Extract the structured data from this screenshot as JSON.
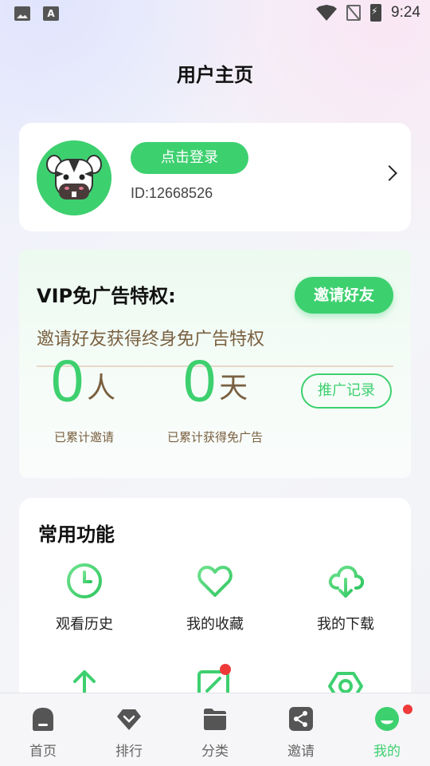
{
  "status_bar": {
    "time": "9:24"
  },
  "page_title": "用户主页",
  "user": {
    "login_label": "点击登录",
    "id_text": "ID:12668526"
  },
  "vip": {
    "title": "VIP免广告特权:",
    "invite_label": "邀请好友",
    "subtitle": "邀请好友获得终身免广告特权",
    "invited_count": "0",
    "invited_unit": "人",
    "invited_label": "已累计邀请",
    "days_count": "0",
    "days_unit": "天",
    "days_label": "已累计获得免广告",
    "record_label": "推广记录"
  },
  "functions": {
    "title": "常用功能",
    "items": [
      {
        "label": "观看历史",
        "icon": "clock-icon"
      },
      {
        "label": "我的收藏",
        "icon": "heart-icon"
      },
      {
        "label": "我的下载",
        "icon": "cloud-download-icon"
      },
      {
        "label": "",
        "icon": "upload-icon"
      },
      {
        "label": "",
        "icon": "edit-icon"
      },
      {
        "label": "",
        "icon": "settings-icon"
      }
    ]
  },
  "nav": {
    "items": [
      {
        "label": "首页",
        "icon": "home-icon"
      },
      {
        "label": "排行",
        "icon": "diamond-icon"
      },
      {
        "label": "分类",
        "icon": "folder-icon"
      },
      {
        "label": "邀请",
        "icon": "share-icon"
      },
      {
        "label": "我的",
        "icon": "profile-icon",
        "active": true
      }
    ]
  },
  "colors": {
    "accent": "#3dd06f",
    "brown": "#7a6040",
    "badge": "#f03a3a"
  }
}
